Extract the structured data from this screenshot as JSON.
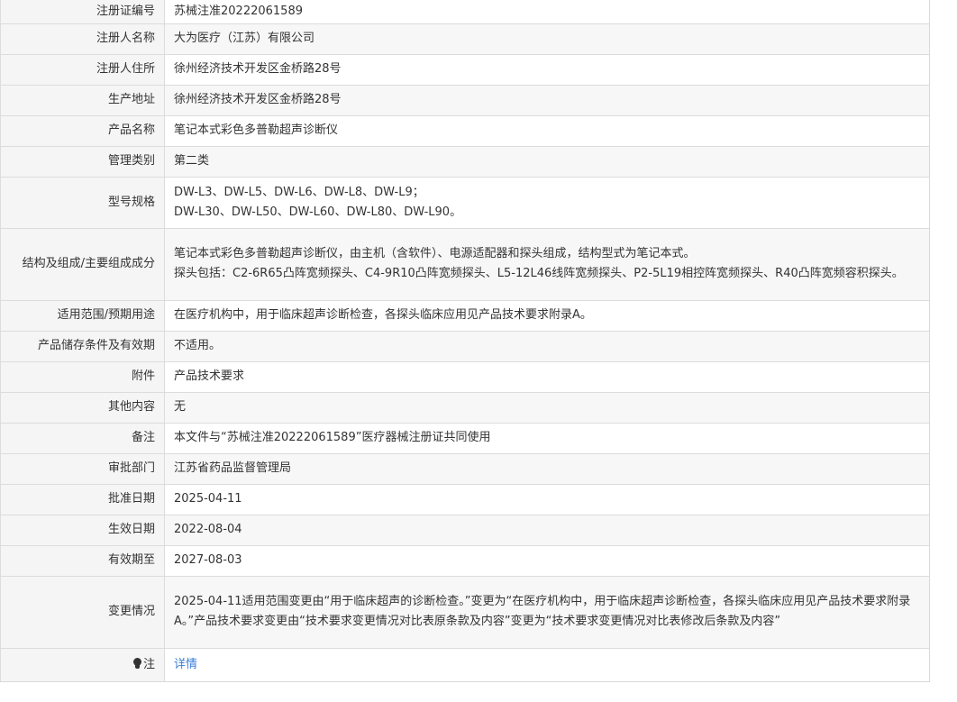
{
  "rows": [
    {
      "label": "注册证编号",
      "value": "苏械注准20222061589"
    },
    {
      "label": "注册人名称",
      "value": "大为医疗（江苏）有限公司"
    },
    {
      "label": "注册人住所",
      "value": "徐州经济技术开发区金桥路28号"
    },
    {
      "label": "生产地址",
      "value": "徐州经济技术开发区金桥路28号"
    },
    {
      "label": "产品名称",
      "value": "笔记本式彩色多普勒超声诊断仪"
    },
    {
      "label": "管理类别",
      "value": "第二类"
    },
    {
      "label": "型号规格",
      "lines": [
        "DW-L3、DW-L5、DW-L6、DW-L8、DW-L9；",
        "DW-L30、DW-L50、DW-L60、DW-L80、DW-L90。"
      ]
    },
    {
      "label": "结构及组成/主要组成成分",
      "lines": [
        "笔记本式彩色多普勒超声诊断仪，由主机（含软件）、电源适配器和探头组成，结构型式为笔记本式。",
        "探头包括：C2-6R65凸阵宽频探头、C4-9R10凸阵宽频探头、L5-12L46线阵宽频探头、P2-5L19相控阵宽频探头、R40凸阵宽频容积探头。"
      ]
    },
    {
      "label": "适用范围/预期用途",
      "value": "在医疗机构中，用于临床超声诊断检查，各探头临床应用见产品技术要求附录A。"
    },
    {
      "label": "产品储存条件及有效期",
      "value": "不适用。"
    },
    {
      "label": "附件",
      "value": "产品技术要求"
    },
    {
      "label": "其他内容",
      "value": "无"
    },
    {
      "label": "备注",
      "value": "本文件与“苏械注准20222061589”医疗器械注册证共同使用"
    },
    {
      "label": "审批部门",
      "value": "江苏省药品监督管理局"
    },
    {
      "label": "批准日期",
      "value": "2025-04-11"
    },
    {
      "label": "生效日期",
      "value": "2022-08-04"
    },
    {
      "label": "有效期至",
      "value": "2027-08-03"
    },
    {
      "label": "变更情况",
      "value": "2025-04-11适用范围变更由“用于临床超声的诊断检查。”变更为“在医疗机构中，用于临床超声诊断检查，各探头临床应用见产品技术要求附录A。”产品技术要求变更由“技术要求变更情况对比表原条款及内容”变更为“技术要求变更情况对比表修改后条款及内容”"
    }
  ],
  "note": {
    "label": "注",
    "icon": "bulb-icon",
    "link_text": "详情"
  },
  "colors": {
    "label_bg": "#f5f5f5",
    "link": "#3b7dd8",
    "border": "#dcdcdc"
  }
}
